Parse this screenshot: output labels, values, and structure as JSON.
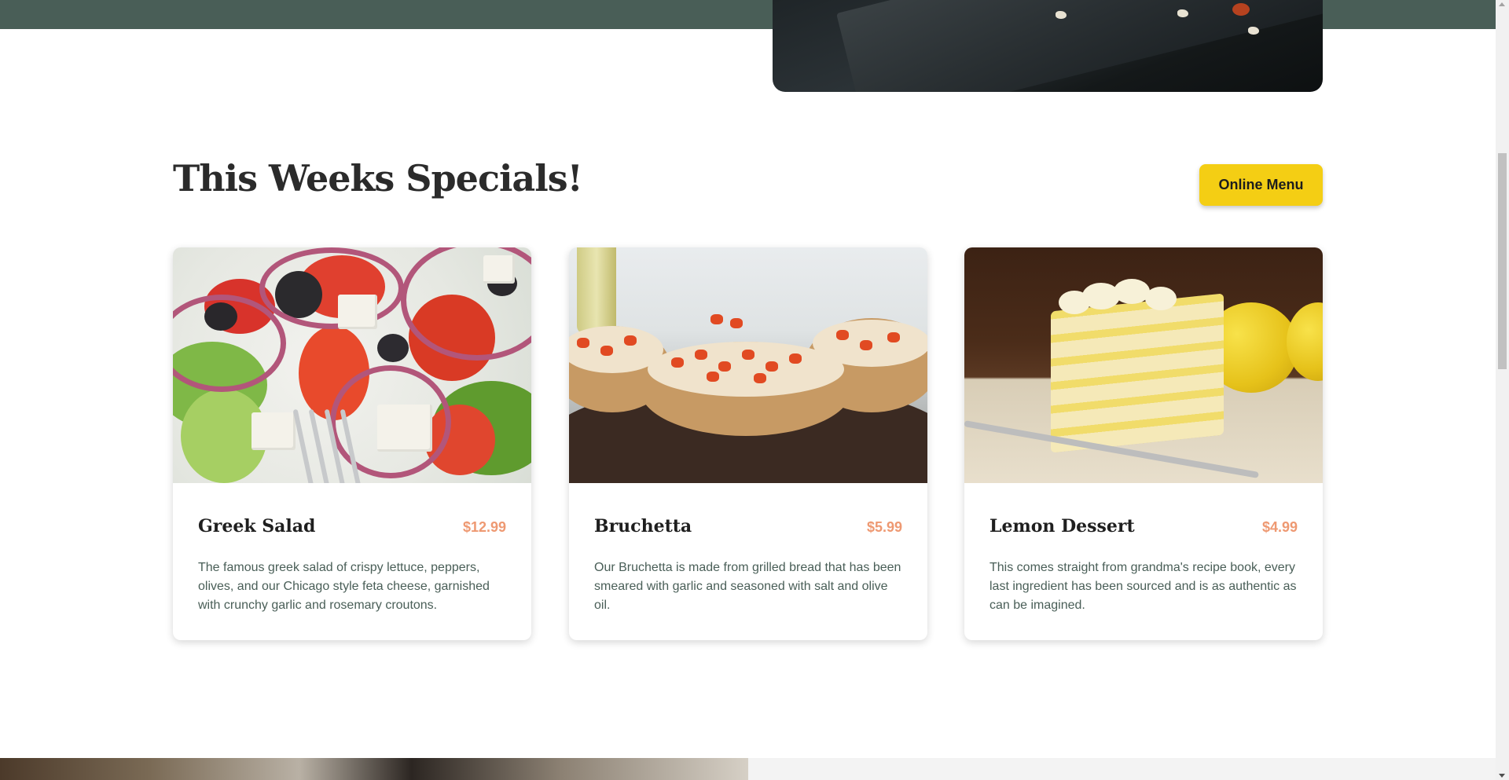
{
  "specials": {
    "title": "This Weeks Specials!",
    "menu_button_label": "Online Menu"
  },
  "cards": [
    {
      "title": "Greek Salad",
      "price": "$12.99",
      "description": "The famous greek salad of crispy lettuce, peppers, olives, and our Chicago style feta cheese, garnished with crunchy garlic and rosemary croutons."
    },
    {
      "title": "Bruchetta",
      "price": "$5.99",
      "description": "Our Bruchetta is made from grilled bread that has been smeared with garlic and seasoned with salt and olive oil."
    },
    {
      "title": "Lemon Dessert",
      "price": "$4.99",
      "description": "This comes straight from grandma's recipe book, every last ingredient has been sourced and is as authentic as can be imagined."
    }
  ],
  "colors": {
    "header_green": "#495e57",
    "button_yellow": "#f4ce14",
    "price_salmon": "#ee9972",
    "text_green": "#495e57"
  }
}
